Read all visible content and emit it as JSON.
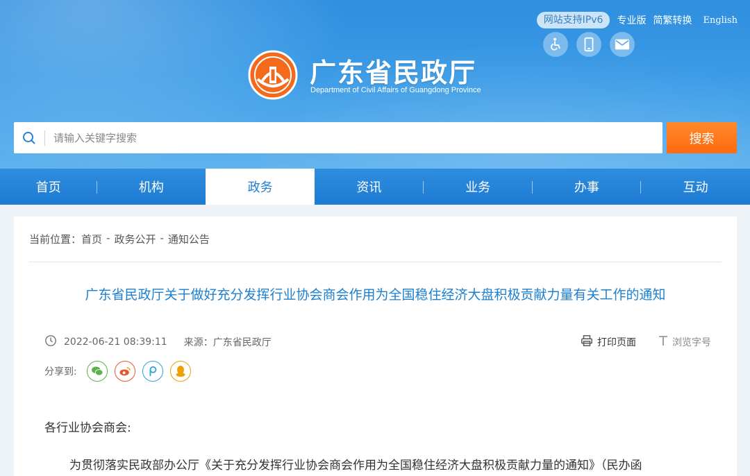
{
  "header": {
    "ipv6_badge": "网站支持IPv6",
    "links": {
      "professional": "专业版",
      "simp_trad": "简繁转换",
      "english": "English"
    },
    "title": "广东省民政厅",
    "subtitle": "Department of Civil Affairs of Guangdong Province",
    "icons": [
      "accessibility-icon",
      "mobile-icon",
      "mail-icon"
    ]
  },
  "search": {
    "placeholder": "请输入关键字搜索",
    "button": "搜索"
  },
  "nav": {
    "items": [
      "首页",
      "机构",
      "政务",
      "资讯",
      "业务",
      "办事",
      "互动"
    ],
    "active_index": 2
  },
  "breadcrumb": {
    "prefix": "当前位置：",
    "items": [
      "首页",
      "政务公开",
      "通知公告"
    ],
    "sep": "-"
  },
  "article": {
    "title": "广东省民政厅关于做好充分发挥行业协会商会作用为全国稳住经济大盘积极贡献力量有关工作的通知",
    "datetime": "2022-06-21 08:39:11",
    "source": "来源：广东省民政厅",
    "print": "打印页面",
    "font_size": "浏览字号",
    "share_label": "分享到:",
    "share_icons": [
      "wechat-icon",
      "weibo-icon",
      "pengyou-icon",
      "qq-icon"
    ],
    "salutation": "各行业协会商会:",
    "paragraph1": "为贯彻落实民政部办公厅《关于充分发挥行业协会商会作用为全国稳住经济大盘积极贡献力量的通知》（民办函"
  },
  "colors": {
    "header_top": "#2f8fe0",
    "nav_bg": "#1d7ad2",
    "accent_orange": "#ff6a10",
    "title_blue": "#1c7fcf",
    "wechat": "#5bb14b",
    "weibo": "#e8542c",
    "pengyou": "#2aa3d6",
    "qq": "#f0a000"
  }
}
